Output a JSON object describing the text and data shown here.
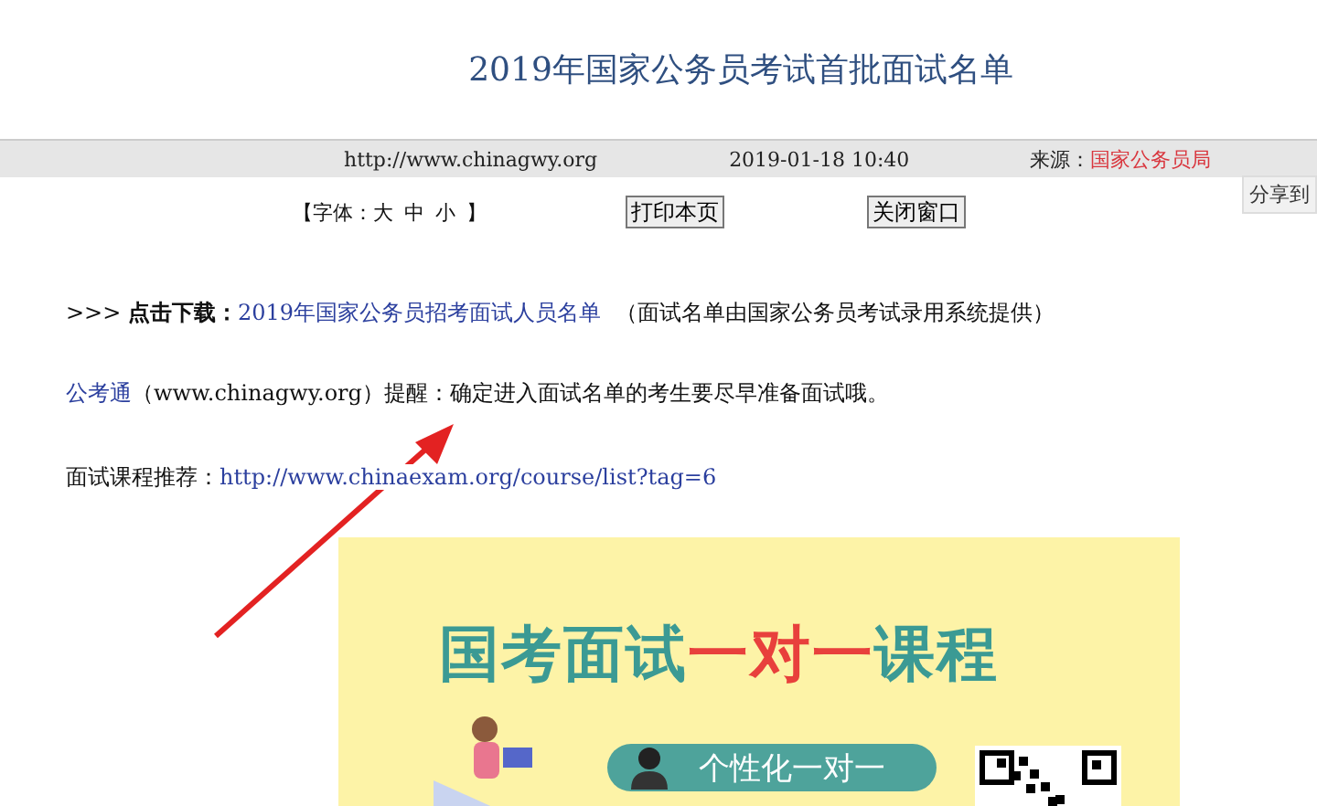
{
  "title": "2019年国家公务员考试首批面试名单",
  "info_bar": {
    "url": "http://www.chinagwy.org",
    "datetime": "2019-01-18 10:40",
    "source_label": "来源：",
    "source": "国家公务员局"
  },
  "font_size": {
    "label_open": "【字体：",
    "options": [
      "大",
      "中",
      "小"
    ],
    "label_close": "】"
  },
  "buttons": [
    "打印本页",
    "关闭窗口"
  ],
  "share_button": "分享到",
  "download": {
    "prefix": ">>> ",
    "label": "点击下载：",
    "link": "2019年国家公务员招考面试人员名单",
    "note": "（面试名单由国家公务员考试录用系统提供）"
  },
  "reminder": {
    "link": "公考通",
    "text": "（www.chinagwy.org）提醒：确定进入面试名单的考生要尽早准备面试哦。"
  },
  "course": {
    "label": "面试课程推荐：",
    "link": "http://www.chinaexam.org/course/list?tag=6"
  },
  "banner": {
    "heading": [
      {
        "text": "国考面试",
        "accent": false
      },
      {
        "text": "一对一",
        "accent": true
      },
      {
        "text": "课程",
        "accent": false
      }
    ],
    "pill": "个性化一对一"
  }
}
